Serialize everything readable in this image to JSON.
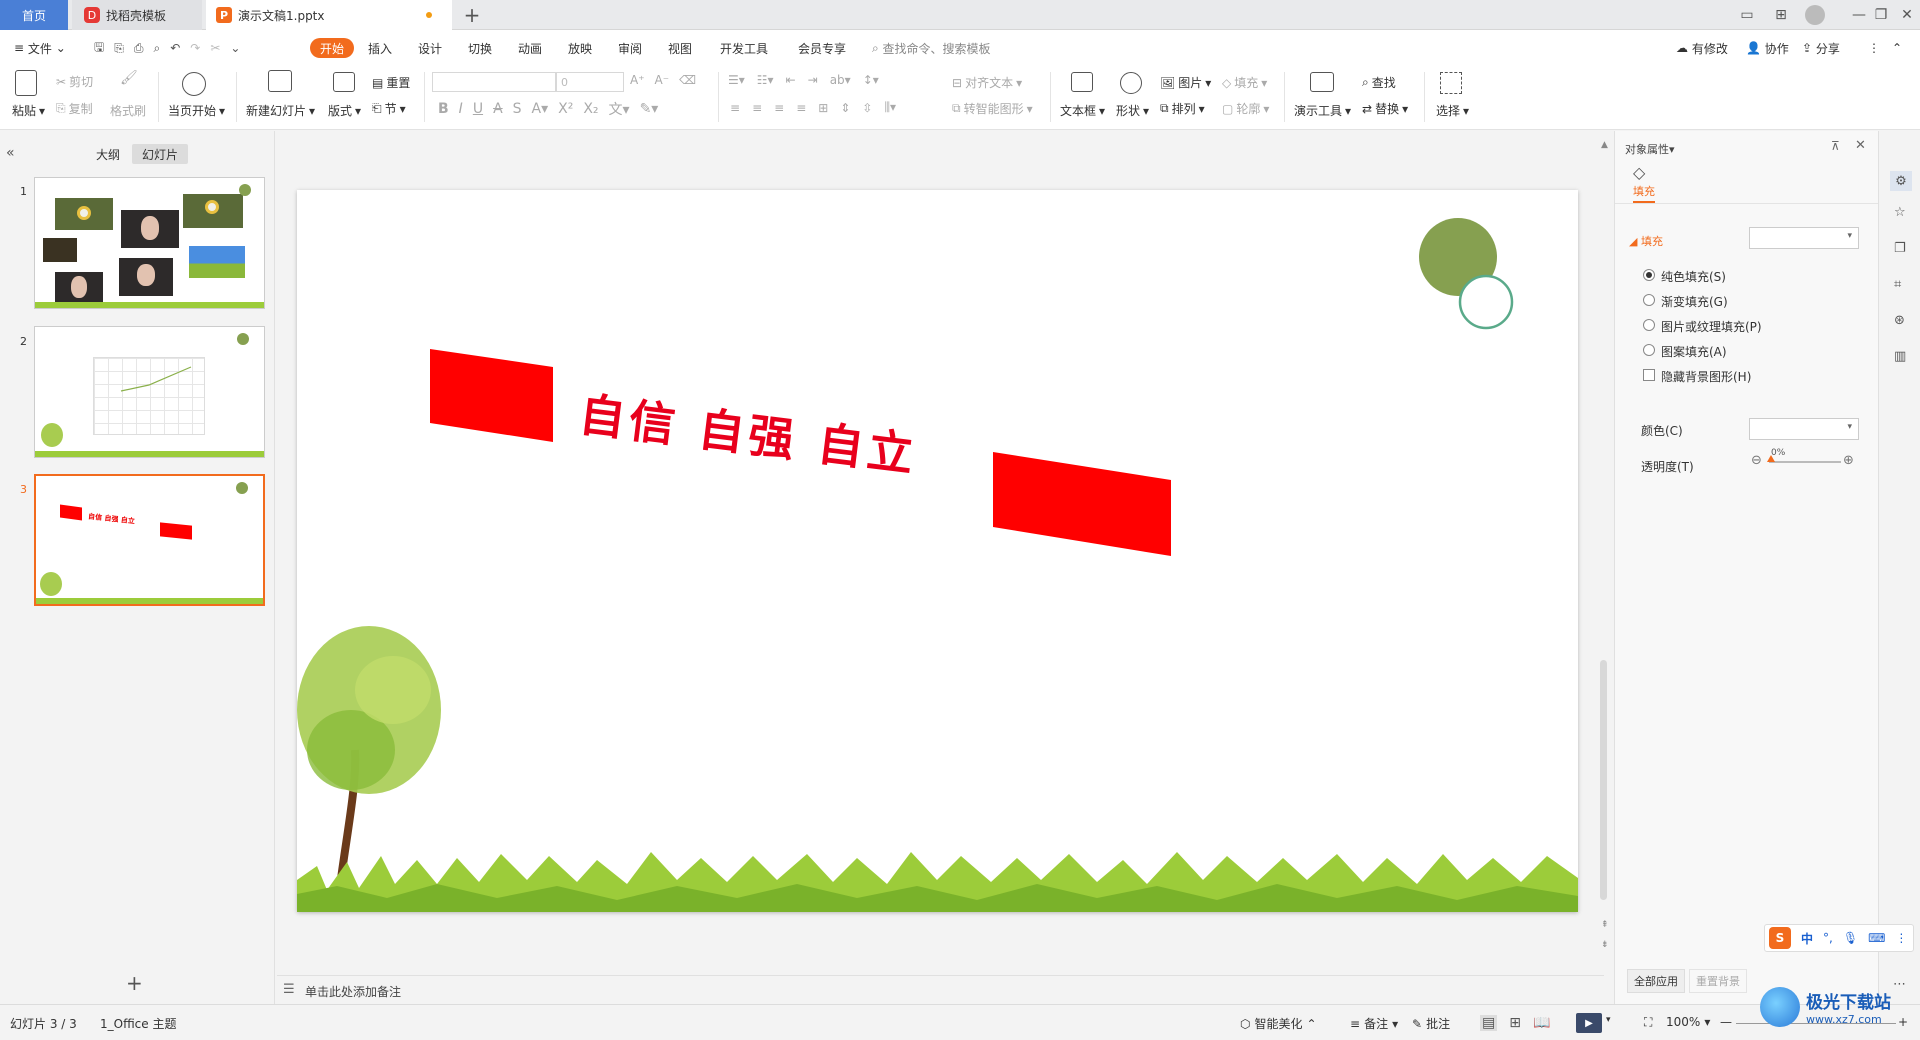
{
  "tabs": {
    "home": "首页",
    "docer": "找稻壳模板",
    "document": "演示文稿1.pptx"
  },
  "menu": {
    "file": "文件",
    "items": [
      "开始",
      "插入",
      "设计",
      "切换",
      "动画",
      "放映",
      "审阅",
      "视图",
      "开发工具",
      "会员专享"
    ],
    "search_placeholder": "查找命令、搜索模板",
    "has_changes": "有修改",
    "collaborate": "协作",
    "share": "分享"
  },
  "ribbon": {
    "paste": "粘贴",
    "cut": "剪切",
    "copy": "复制",
    "format_painter": "格式刷",
    "start_from_current": "当页开始",
    "new_slide": "新建幻灯片",
    "layout": "版式",
    "reset": "重置",
    "section": "节",
    "font_size": "0",
    "align_text": "对齐文本",
    "convert_smartart": "转智能图形",
    "textbox": "文本框",
    "shape": "形状",
    "picture": "图片",
    "arrange": "排列",
    "fill": "填充",
    "outline": "轮廓",
    "presenter_tools": "演示工具",
    "find": "查找",
    "replace": "替换",
    "select": "选择"
  },
  "left_panel": {
    "outline_tab": "大纲",
    "slides_tab": "幻灯片",
    "slide_numbers": [
      "1",
      "2",
      "3"
    ]
  },
  "slide": {
    "main_text": "自信 自强 自立"
  },
  "thumb3_text": "自信 自强 自立",
  "notes_placeholder": "单击此处添加备注",
  "right_panel": {
    "title": "对象属性",
    "tab_fill": "填充",
    "section_fill": "填充",
    "options": [
      "纯色填充(S)",
      "渐变填充(G)",
      "图片或纹理填充(P)",
      "图案填充(A)"
    ],
    "hide_bg_graphics": "隐藏背景图形(H)",
    "color_label": "颜色(C)",
    "transparency_label": "透明度(T)",
    "transparency_value": "0%",
    "apply_all": "全部应用",
    "reset_bg": "重置背景"
  },
  "status": {
    "slide_counter": "幻灯片 3 / 3",
    "theme": "1_Office 主题",
    "smart_beautify": "智能美化",
    "notes": "备注",
    "comments": "批注",
    "zoom": "100%"
  },
  "ime": {
    "lang": "中"
  },
  "watermark": {
    "text": "极光下载站",
    "url": "www.xz7.com"
  },
  "colors": {
    "accent": "#f26b1d",
    "home_tab": "#4a7fd6",
    "red_shape": "#ff0000",
    "circle_green": "#86a050",
    "circle_outline": "#5aaa8a"
  }
}
